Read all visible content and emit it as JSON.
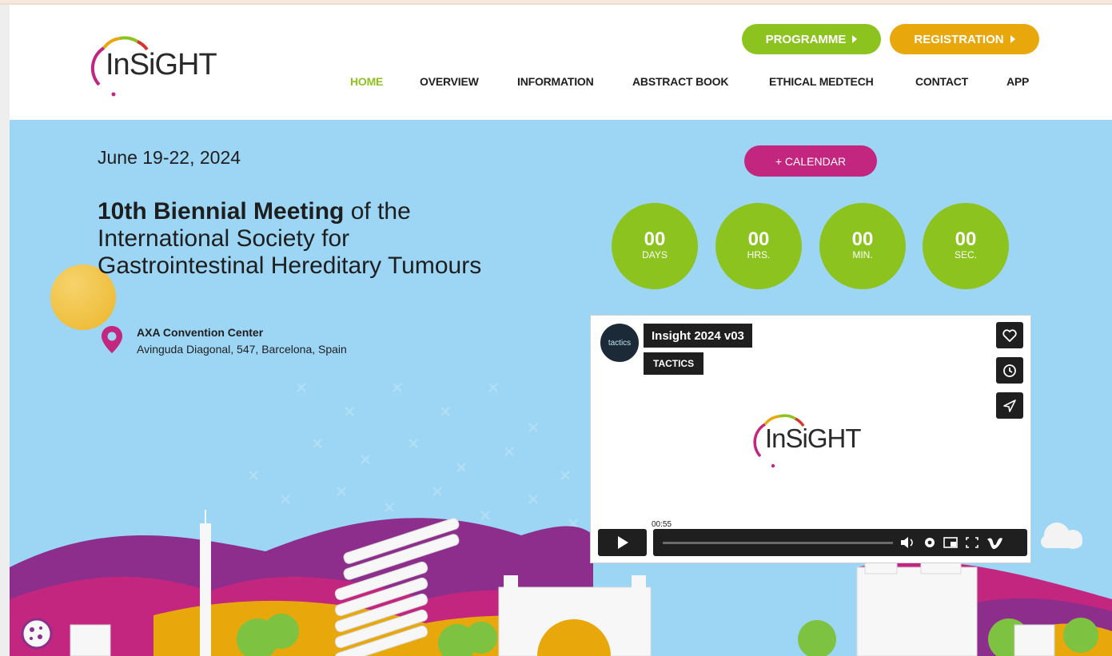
{
  "header": {
    "logo_text": "InSiGHT",
    "buttons": {
      "programme": "PROGRAMME",
      "registration": "REGISTRATION"
    },
    "nav": [
      "HOME",
      "OVERVIEW",
      "INFORMATION",
      "ABSTRACT BOOK",
      "ETHICAL MEDTECH",
      "CONTACT",
      "APP"
    ],
    "active_nav": "HOME"
  },
  "hero": {
    "dates": "June 19-22, 2024",
    "title_bold": "10th Biennial Meeting",
    "title_rest": " of the",
    "title_line2": "International Society for",
    "title_line3": "Gastrointestinal Hereditary Tumours",
    "venue_name": "AXA Convention Center",
    "venue_address": "Avinguda Diagonal, 547, Barcelona, Spain",
    "calendar_button": "+ CALENDAR",
    "countdown": [
      {
        "value": "00",
        "unit": "DAYS"
      },
      {
        "value": "00",
        "unit": "HRS."
      },
      {
        "value": "00",
        "unit": "MIN."
      },
      {
        "value": "00",
        "unit": "SEC."
      }
    ]
  },
  "video": {
    "channel_avatar": "tactics",
    "title": "Insight 2024 v03",
    "channel": "TACTICS",
    "logo_text": "InSiGHT",
    "time": "00:55",
    "side_icons": [
      "heart-icon",
      "clock-icon",
      "send-icon"
    ],
    "controls": [
      "volume-icon",
      "settings-icon",
      "pip-icon",
      "fullscreen-icon",
      "vimeo-icon"
    ]
  },
  "colors": {
    "green": "#8cc31f",
    "orange": "#e8a80c",
    "magenta": "#c2267f",
    "sky": "#9dd6f5"
  }
}
